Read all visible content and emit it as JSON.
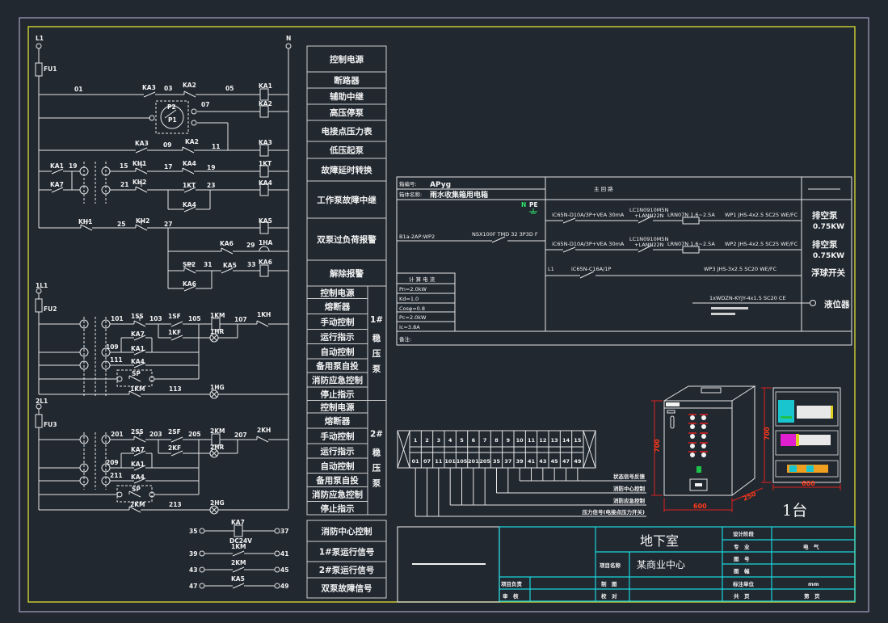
{
  "colors": {
    "background": "#212830",
    "frame": "#c8c832",
    "border": "#8a8aa8",
    "title_grid": "#19d6dc",
    "dimension": "#e02020"
  },
  "control_circuit": {
    "labels": [
      "L1",
      "N",
      "FU1",
      "01",
      "KA3",
      "03",
      "KA2",
      "05",
      "KA1",
      "07",
      "KA2",
      "P2",
      "P1",
      "KA3",
      "09",
      "KA2",
      "11",
      "KA3",
      "KA1",
      "19",
      "15",
      "KH1",
      "17",
      "KA4",
      "19",
      "1KT",
      "KA7",
      "21",
      "KH2",
      "1KT",
      "23",
      "KA4",
      "KA4",
      "KH1",
      "25",
      "KH2",
      "27",
      "KA5",
      "KA6",
      "29",
      "1HA",
      "SP2",
      "31",
      "KA5",
      "33",
      "KA6",
      "KA6"
    ]
  },
  "pump_1": {
    "labels": [
      "1L1",
      "FU2",
      "101",
      "1SS",
      "103",
      "1SF",
      "105",
      "1KM",
      "107",
      "1KH",
      "1KF",
      "1HR",
      "KA7",
      "109",
      "KA1",
      "111",
      "KA4",
      "SP",
      "1KM",
      "113",
      "1HG"
    ]
  },
  "pump_2": {
    "labels": [
      "2L1",
      "FU3",
      "201",
      "2SS",
      "203",
      "2SF",
      "205",
      "2KM",
      "207",
      "2KH",
      "2KF",
      "2HR",
      "KA7",
      "209",
      "KA1",
      "211",
      "KA4",
      "SP",
      "2KM",
      "213",
      "2HG"
    ]
  },
  "signal_terminals": {
    "labels": [
      "35",
      "KA7",
      "37",
      "DC24V",
      "39",
      "1KM",
      "41",
      "43",
      "2KM",
      "45",
      "47",
      "KA5",
      "49"
    ]
  },
  "function_table": {
    "top": [
      "控制电源",
      "断路器",
      "辅助中继",
      "高压停泵",
      "电接点压力表",
      "低压起泵",
      "故障延时转换",
      "工作泵故障中继",
      "双泵过负荷报警",
      "解除报警"
    ],
    "pump_1": {
      "title": "1#",
      "name": [
        "稳",
        "压",
        "泵"
      ],
      "rows": [
        "控制电源",
        "熔断器",
        "手动控制",
        "运行指示",
        "自动控制",
        "备用泵自投",
        "消防应急控制",
        "停止指示"
      ]
    },
    "pump_2": {
      "title": "2#",
      "name": [
        "稳",
        "压",
        "泵"
      ],
      "rows": [
        "控制电源",
        "熔断器",
        "手动控制",
        "运行指示",
        "自动控制",
        "备用泵自投",
        "消防应急控制",
        "停止指示"
      ]
    },
    "bottom": [
      "消防中心控制",
      "1#泵运行信号",
      "2#泵运行信号",
      "双泵故障信号"
    ]
  },
  "distribution_box": {
    "box_no_label": "箱编号:",
    "box_no": "APyg",
    "box_name_label": "箱体名称:",
    "box_name": "雨水收集箱用电箱",
    "main_circuit": "主 回 路",
    "neutral": "N",
    "earth": "PE",
    "incoming": {
      "source": "B1a-2AP:WP2",
      "breaker": "NSX100F TMD 32 3P3D F"
    },
    "circuits": [
      {
        "breaker": "iC65N-D10A/3P+VEA 30mA",
        "contactor": "LC1N0910M5N",
        "contactor_aux": "+LANN22N",
        "relay": "LRN07N 1.6~2.5A",
        "cable": "WP1  JHS-4x2.5 SC25 WE/FC",
        "load": "排空泵",
        "power": "0.75KW"
      },
      {
        "breaker": "iC65N-D10A/3P+VEA 30mA",
        "contactor": "LC1N0910M5N",
        "contactor_aux": "+LANN22N",
        "relay": "LRN07N 1.6~2.5A",
        "cable": "WP2  JHS-4x2.5 SC25 WE/FC",
        "load": "排空泵",
        "power": "0.75KW"
      },
      {
        "phase": "L1",
        "breaker": "iC65N-C16A/1P",
        "cable": "WP3  JHS-3x2.5 SC20 WE/FC",
        "load": "浮球开关"
      },
      {
        "cable": "1xWDZN-KYJY-4x1.5 SC20 CE",
        "load": "液位器"
      }
    ],
    "calc": {
      "title": "计 算 电 流",
      "rows": [
        "Pn=2.0kW",
        "Kd=1.0",
        "Cosφ=0.8",
        "Pc=2.0kW",
        "Ic=3.8A"
      ]
    },
    "remark": "备注:"
  },
  "terminal_block": {
    "numbers": [
      "1",
      "2",
      "3",
      "4",
      "5",
      "6",
      "7",
      "8",
      "9",
      "10",
      "11",
      "12",
      "13",
      "14",
      "15"
    ],
    "wires": [
      "01",
      "07",
      "11",
      "101",
      "105",
      "201",
      "205",
      "35",
      "37",
      "39",
      "41",
      "43",
      "45",
      "47",
      "49"
    ],
    "signal_groups": [
      "状态信号反馈",
      "消防中心控制",
      "消防应急控制",
      "压力信号(电接点压力开关)"
    ]
  },
  "cabinet": {
    "front_height": "700",
    "front_width": "600",
    "depth": "250",
    "panel_height": "700",
    "panel_width": "600",
    "quantity": "1台"
  },
  "title_block": {
    "drawing_title": "地下室",
    "project_label": "项目名称",
    "project_name": "某商业中心",
    "project_lead": "项目负责",
    "review": "审　核",
    "drawn": "制　图",
    "check": "校　对",
    "design_stage": "设计阶段",
    "discipline_label": "专　业",
    "discipline": "电　气",
    "drawing_no": "图　号",
    "sheet_size": "图　幅",
    "unit_label": "标注单位",
    "unit": "mm",
    "total": "共　页",
    "page": "第　页"
  }
}
